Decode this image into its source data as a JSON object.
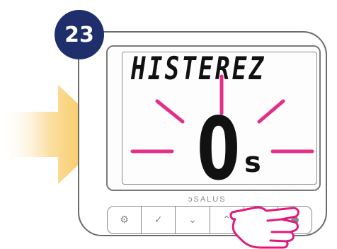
{
  "step": {
    "number": "23"
  },
  "display": {
    "label": "HISTEREZ",
    "value": "0",
    "unit": "s"
  },
  "device": {
    "brand": "SALUS"
  },
  "buttons": [
    {
      "icon": "gear-icon",
      "glyph": "⚙"
    },
    {
      "icon": "check-icon",
      "glyph": "✓"
    },
    {
      "icon": "chevron-down-icon",
      "glyph": "⌄"
    },
    {
      "icon": "chevron-up-icon",
      "glyph": "⌃"
    },
    {
      "icon": "check-icon",
      "glyph": "✓"
    },
    {
      "icon": "power-icon",
      "glyph": "●"
    }
  ],
  "colors": {
    "badge": "#1f2f6b",
    "rays": "#e0197d",
    "arrow": "#f5b82a"
  }
}
